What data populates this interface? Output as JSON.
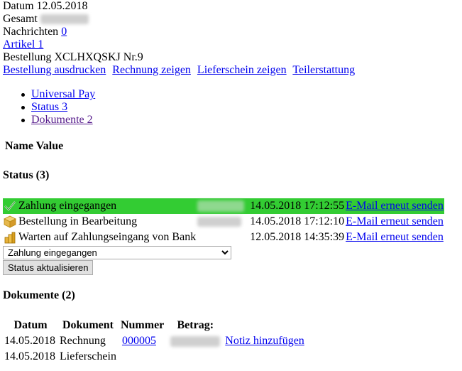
{
  "info": {
    "date_label": "Datum",
    "date_value": "12.05.2018",
    "total_label": "Gesamt",
    "messages_label": "Nachrichten",
    "messages_count": "0",
    "articles_link": "Artikel 1",
    "order_title": "Bestellung XCLHXQSKJ Nr.9"
  },
  "actions": {
    "print_order": "Bestellung ausdrucken",
    "show_invoice": "Rechnung zeigen",
    "show_delivery_note": "Lieferschein zeigen",
    "partial_refund": "Teilerstattung"
  },
  "menu": [
    {
      "label": "Universal Pay"
    },
    {
      "label": "Status 3"
    },
    {
      "label": "Dokumente 2"
    }
  ],
  "name_value_header": "Name Value",
  "status_section": {
    "heading": "Status (3)",
    "rows": [
      {
        "label": "Zahlung eingegangen",
        "timestamp": "14.05.2018 17:12:55",
        "action": "E-Mail erneut senden",
        "icon": "checkmark-icon",
        "active": true
      },
      {
        "label": "Bestellung in Bearbeitung",
        "timestamp": "14.05.2018 17:12:10",
        "action": "E-Mail erneut senden",
        "icon": "package-icon",
        "active": false
      },
      {
        "label": "Warten auf Zahlungseingang von Bank",
        "timestamp": "12.05.2018 14:35:39",
        "action": "E-Mail erneut senden",
        "icon": "money-bag-icon",
        "active": false
      }
    ],
    "select_value": "Zahlung eingegangen",
    "update_button": "Status aktualisieren"
  },
  "documents_section": {
    "heading": "Dokumente (2)",
    "columns": [
      "Datum",
      "Dokument",
      "Nummer",
      "Betrag:"
    ],
    "rows": [
      {
        "date": "14.05.2018",
        "doc": "Rechnung",
        "number": "000005",
        "note_link": "Notiz hinzufügen"
      },
      {
        "date": "14.05.2018",
        "doc": "Lieferschein",
        "number": "",
        "note_link": ""
      }
    ]
  },
  "colors": {
    "active_row": "#33cc33",
    "link": "#0000ee",
    "visited_link": "#551a8b"
  }
}
